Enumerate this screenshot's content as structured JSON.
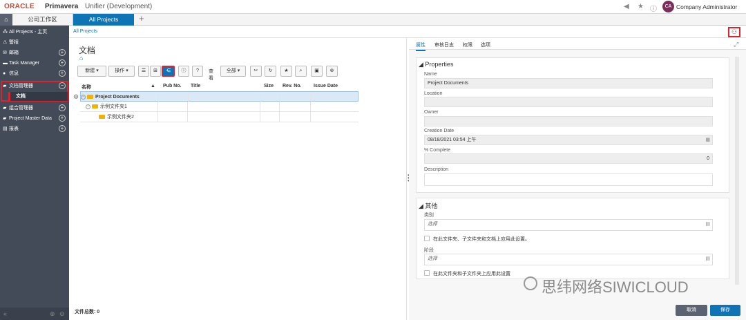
{
  "topbar": {
    "logo": "ORACLE",
    "product": "Primavera",
    "product_sub": "Unifier (Development)",
    "user_initials": "CA",
    "user_name": "Company Administrator"
  },
  "tabs": {
    "workspace": "公司工作区",
    "project": "All Projects",
    "add": "+"
  },
  "sidebar": {
    "items": [
      {
        "label": "All Projects - 主页",
        "icon": "tree-icon"
      },
      {
        "label": "警报",
        "icon": "warning-icon"
      },
      {
        "label": "邮箱",
        "icon": "mail-icon"
      },
      {
        "label": "Task Manager",
        "icon": "task-icon"
      },
      {
        "label": "信息",
        "icon": "info-icon"
      },
      {
        "label": "文档管理器",
        "icon": "folder-icon"
      },
      {
        "label": "组合管理器",
        "icon": "folder-icon"
      },
      {
        "label": "Project Master Data",
        "icon": "folder-icon"
      },
      {
        "label": "报表",
        "icon": "report-icon"
      }
    ],
    "selected_sub": "文档"
  },
  "breadcrumb": "All Projects",
  "doc": {
    "title": "文档",
    "toolbar": {
      "new_label": "新建 ▾",
      "actions_label": "操作 ▾",
      "view_label": "查看",
      "view_select": "全部 ▾"
    },
    "columns": [
      "名称",
      "Pub No.",
      "Title",
      "Size",
      "Rev. No.",
      "Issue Date"
    ],
    "rows": [
      {
        "name": "Project Documents"
      },
      {
        "name": "示例文件夹1"
      },
      {
        "name": "示例文件夹2"
      }
    ],
    "footer": "文件总数: 0"
  },
  "details": {
    "tabs": [
      "属性",
      "审核日志",
      "权限",
      "选项"
    ],
    "properties_title": "Properties",
    "fields": {
      "name_label": "Name",
      "name_value": "Project Documents",
      "location_label": "Location",
      "owner_label": "Owner",
      "creation_label": "Creation Date",
      "creation_value": "08/18/2021 03:54 上午",
      "complete_label": "% Complete",
      "complete_value": "0",
      "description_label": "Description"
    },
    "other_title": "其他",
    "category_label": "类别",
    "category_placeholder": "选择",
    "apply1_label": "在此文件夹、子文件夹和文档上应用此设置。",
    "phase_label": "阶段",
    "phase_placeholder": "选择",
    "apply2_label": "在此文件夹和子文件夹上应用此设置",
    "cancel_label": "取消",
    "save_label": "保存"
  },
  "watermark": "思纬网络SIWICLOUD"
}
